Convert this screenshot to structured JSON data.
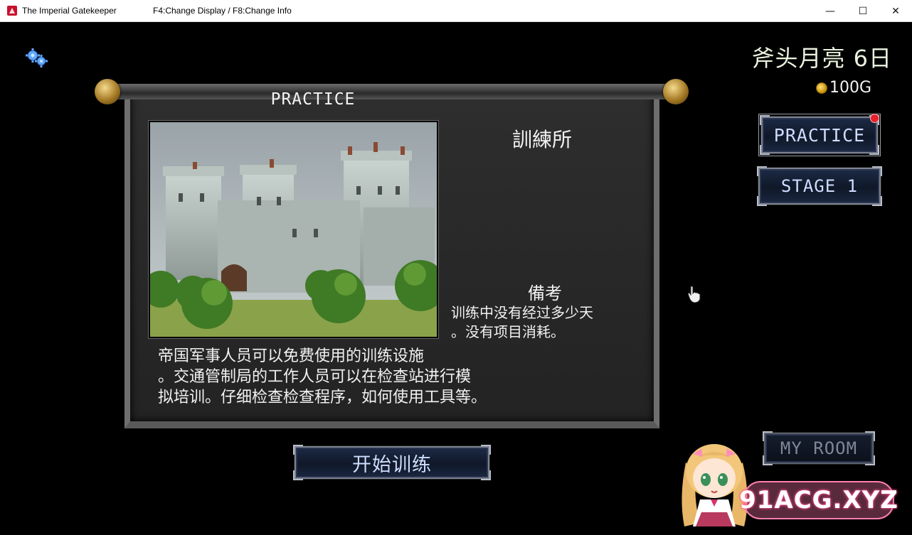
{
  "window": {
    "title": "The Imperial Gatekeeper",
    "hint": "F4:Change Display / F8:Change Info",
    "minimize_glyph": "—",
    "maximize_glyph": "☐",
    "close_glyph": "✕"
  },
  "hud": {
    "date": "斧头月亮 6日",
    "gold": "100G"
  },
  "panel": {
    "title": "PRACTICE",
    "facility_name": "訓練所",
    "notes_title": "備考",
    "notes_text": "训练中没有经过多少天\n。没有项目消耗。",
    "description": "帝国军事人员可以免费使用的训练设施\n。交通管制局的工作人员可以在检查站进行模\n拟培训。仔细检查检查程序，如何使用工具等。",
    "start_button": "开始训练"
  },
  "menu": {
    "practice": "PRACTICE",
    "stage": "STAGE 1",
    "my_room": "MY ROOM"
  },
  "watermark": "91ACG.XYZ",
  "icons": [
    "settings-gear-icon",
    "gold-coin-icon",
    "hand-cursor-icon",
    "notification-dot-icon"
  ],
  "colors": {
    "button_text": "#cfdcff",
    "button_bg": "#0f1828",
    "notify": "#e5212b",
    "panel": "#2a2a2a"
  }
}
